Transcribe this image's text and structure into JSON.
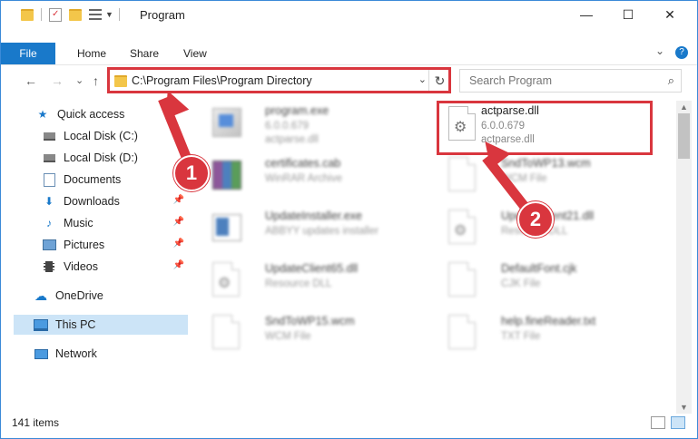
{
  "window": {
    "title": "Program",
    "minimize": "—",
    "maximize": "☐",
    "close": "✕"
  },
  "ribbon": {
    "tabs": [
      "File",
      "Home",
      "Share",
      "View"
    ],
    "help": "?",
    "collapse": "⌄"
  },
  "address": {
    "path": "C:\\Program Files\\Program Directory",
    "dropdown": "⌄",
    "refresh": "↻"
  },
  "search": {
    "placeholder": "Search Program",
    "icon": "search-icon"
  },
  "nav": {
    "back": "←",
    "forward": "→",
    "recent": "⌄",
    "up": "↑"
  },
  "sidebar": {
    "items": [
      {
        "label": "Quick access",
        "icon": "star-icon"
      },
      {
        "label": "Local Disk (C:)",
        "icon": "drive-icon"
      },
      {
        "label": "Local Disk (D:)",
        "icon": "drive-icon"
      },
      {
        "label": "Documents",
        "icon": "documents-icon"
      },
      {
        "label": "Downloads",
        "icon": "download-icon"
      },
      {
        "label": "Music",
        "icon": "music-icon"
      },
      {
        "label": "Pictures",
        "icon": "pictures-icon"
      },
      {
        "label": "Videos",
        "icon": "videos-icon"
      },
      {
        "label": "OneDrive",
        "icon": "cloud-icon"
      },
      {
        "label": "This PC",
        "icon": "computer-icon"
      },
      {
        "label": "Network",
        "icon": "network-icon"
      }
    ]
  },
  "files": [
    {
      "name": "program.exe",
      "line2": "6.0.0.679",
      "line3": "actparse.dll"
    },
    {
      "name": "actparse.dll",
      "line2": "6.0.0.679",
      "line3": "actparse.dll"
    },
    {
      "name": "certificates.cab",
      "line2": "WinRAR Archive",
      "line3": ""
    },
    {
      "name": "SndToWP13.wcm",
      "line2": "WCM File",
      "line3": ""
    },
    {
      "name": "UpdateInstaller.exe",
      "line2": "ABBYY updates installer",
      "line3": ""
    },
    {
      "name": "UpdateClient21.dll",
      "line2": "Resource DLL",
      "line3": ""
    },
    {
      "name": "UpdateClient65.dll",
      "line2": "Resource DLL",
      "line3": ""
    },
    {
      "name": "DefaultFont.cjk",
      "line2": "CJK File",
      "line3": ""
    },
    {
      "name": "SndToWP15.wcm",
      "line2": "WCM File",
      "line3": ""
    },
    {
      "name": "help.fineReader.txt",
      "line2": "TXT File",
      "line3": ""
    }
  ],
  "status": {
    "count": "141 items"
  },
  "annotations": {
    "step1": "1",
    "step2": "2"
  },
  "colors": {
    "accent": "#1979ca",
    "highlight": "#d9363e",
    "selected": "#cce4f7"
  }
}
